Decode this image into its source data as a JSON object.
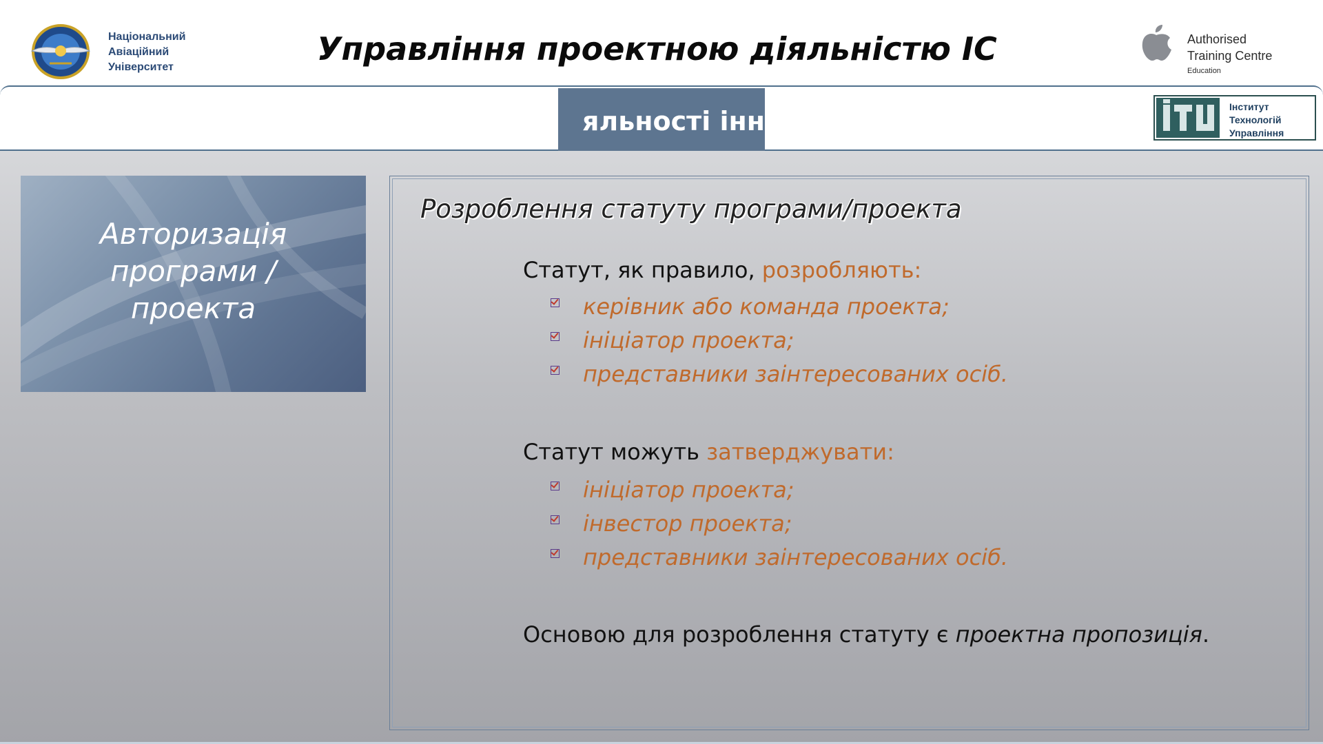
{
  "header": {
    "university_name": [
      "Національний",
      "Авіаційний",
      "Університет"
    ],
    "title": "Управління проектною діяльністю ІС",
    "apple_badge": {
      "line1": "Authorised",
      "line2": "Training Centre",
      "line3": "Education"
    }
  },
  "banner": {
    "tab_text": "яльності інн",
    "itu_logo_text": [
      "Інститут",
      "Технологій",
      "Управління"
    ]
  },
  "side_panel": {
    "title_lines": [
      "Авторизація",
      "програми /",
      "проекта"
    ]
  },
  "main": {
    "section_title": "Розроблення статуту програми/проекта",
    "block1": {
      "lead": "Статут, як правило, ",
      "accent": "розробляють:",
      "items": [
        "керівник або команда проекта;",
        "ініціатор проекта;",
        "представники заінтересованих осіб."
      ]
    },
    "block2": {
      "lead": "Статут можуть ",
      "accent": "затверджувати:",
      "items": [
        "ініціатор проекта;",
        "інвестор проекта;",
        "представники заінтересованих осіб."
      ]
    },
    "block3": {
      "lead": "Основою для розроблення статуту є ",
      "emphasis": "проектна пропозиція",
      "trail": "."
    }
  },
  "colors": {
    "accent_orange": "#c06a2c",
    "banner_blue": "#5d7590",
    "frame_blue": "#4f6f8c"
  }
}
